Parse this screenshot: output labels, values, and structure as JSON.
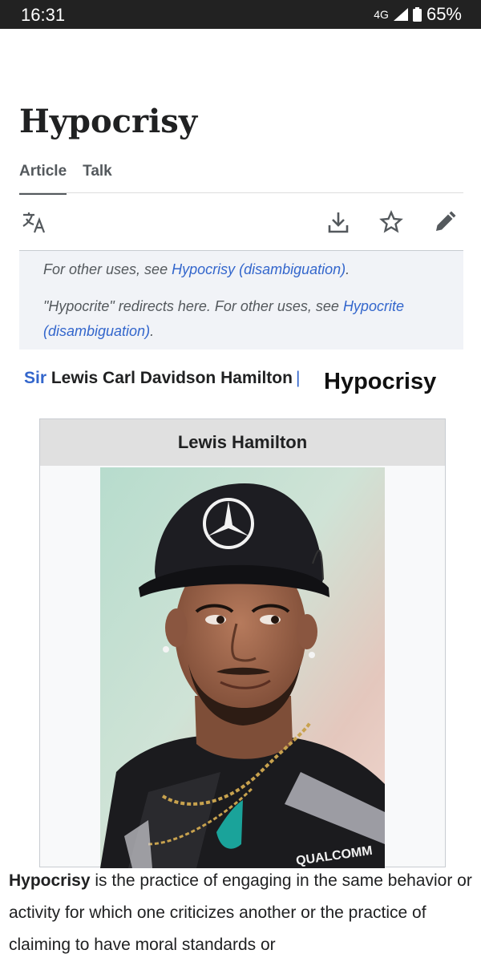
{
  "status_bar": {
    "time": "16:31",
    "network": "4G",
    "battery": "65%"
  },
  "article": {
    "title": "Hypocrisy",
    "tabs": [
      {
        "label": "Article",
        "active": true
      },
      {
        "label": "Talk",
        "active": false
      }
    ],
    "toolbar": {
      "icons": [
        "language-icon",
        "download-icon",
        "star-icon",
        "edit-icon"
      ]
    },
    "hatnotes": [
      {
        "prefix": "For other uses, see ",
        "link": "Hypocrisy (disambiguation)",
        "suffix": "."
      },
      {
        "prefix": "\"Hypocrite\" redirects here. For other uses, see ",
        "link_line1": "Hypocrite",
        "link_line2": "(disambiguation)",
        "suffix": "."
      }
    ],
    "name_line": {
      "sir": "Sir",
      "name": "Lewis Carl Davidson Hamilton",
      "overlay": "Hypocrisy"
    },
    "infobox": {
      "header": "Lewis Hamilton",
      "cap_logo": "mercedes-star-icon",
      "shirt_text": "QUALCOMM"
    },
    "lead": {
      "bold": "Hypocrisy",
      "text": " is the practice of engaging in the same behavior or activity for which one criticizes another or the practice of claiming to have moral standards or"
    }
  },
  "colors": {
    "link": "#3366cc",
    "text": "#202122",
    "muted": "#54595d",
    "hatnote_bg": "#f1f3f7",
    "status_bar": "#222222"
  }
}
